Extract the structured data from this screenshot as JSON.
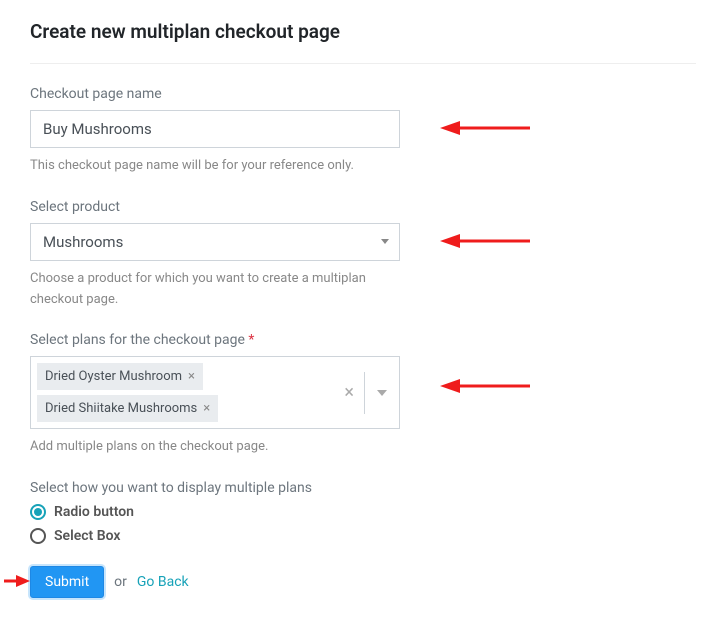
{
  "page_title": "Create new multiplan checkout page",
  "fields": {
    "name": {
      "label": "Checkout page name",
      "value": "Buy Mushrooms",
      "help": "This checkout page name will be for your reference only."
    },
    "product": {
      "label": "Select product",
      "value": "Mushrooms",
      "help": "Choose a product for which you want to create a multiplan checkout page."
    },
    "plans": {
      "label": "Select plans for the checkout page",
      "tags": [
        "Dried Oyster Mushroom",
        "Dried Shiitake Mushrooms"
      ],
      "help": "Add multiple plans on the checkout page."
    },
    "display": {
      "label": "Select how you want to display multiple plans",
      "options": [
        "Radio button",
        "Select Box"
      ],
      "selected": "Radio button"
    }
  },
  "actions": {
    "submit": "Submit",
    "or": "or",
    "goback": "Go Back"
  }
}
